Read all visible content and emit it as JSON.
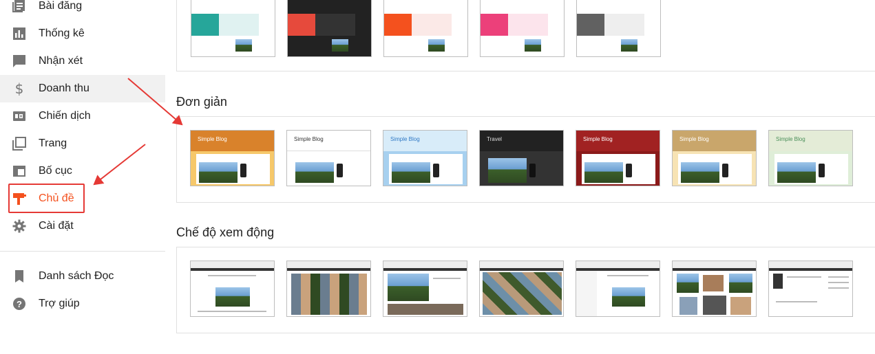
{
  "sidebar": {
    "items": [
      {
        "label": "Bài đăng",
        "icon": "posts-icon"
      },
      {
        "label": "Thống kê",
        "icon": "stats-icon"
      },
      {
        "label": "Nhận xét",
        "icon": "comment-icon"
      },
      {
        "label": "Doanh thu",
        "icon": "dollar-icon"
      },
      {
        "label": "Chiến dịch",
        "icon": "ad-icon"
      },
      {
        "label": "Trang",
        "icon": "pages-icon"
      },
      {
        "label": "Bố cục",
        "icon": "layout-icon"
      },
      {
        "label": "Chủ đề",
        "icon": "theme-paint-icon"
      },
      {
        "label": "Cài đặt",
        "icon": "gear-icon"
      }
    ],
    "secondary": [
      {
        "label": "Danh sách Đọc",
        "icon": "bookmark-icon"
      },
      {
        "label": "Trợ giúp",
        "icon": "help-icon"
      }
    ],
    "active_color": "#f4511e"
  },
  "main": {
    "sections": [
      {
        "title": "Đơn giản"
      },
      {
        "title": "Chế độ xem động"
      }
    ],
    "simple_thumb_titles": [
      "Simple Blog",
      "Simple Blog",
      "Simple Blog",
      "Travel",
      "Simple Blog",
      "Simple Blog",
      "Simple Blog"
    ]
  },
  "annotation_color": "#e53935"
}
